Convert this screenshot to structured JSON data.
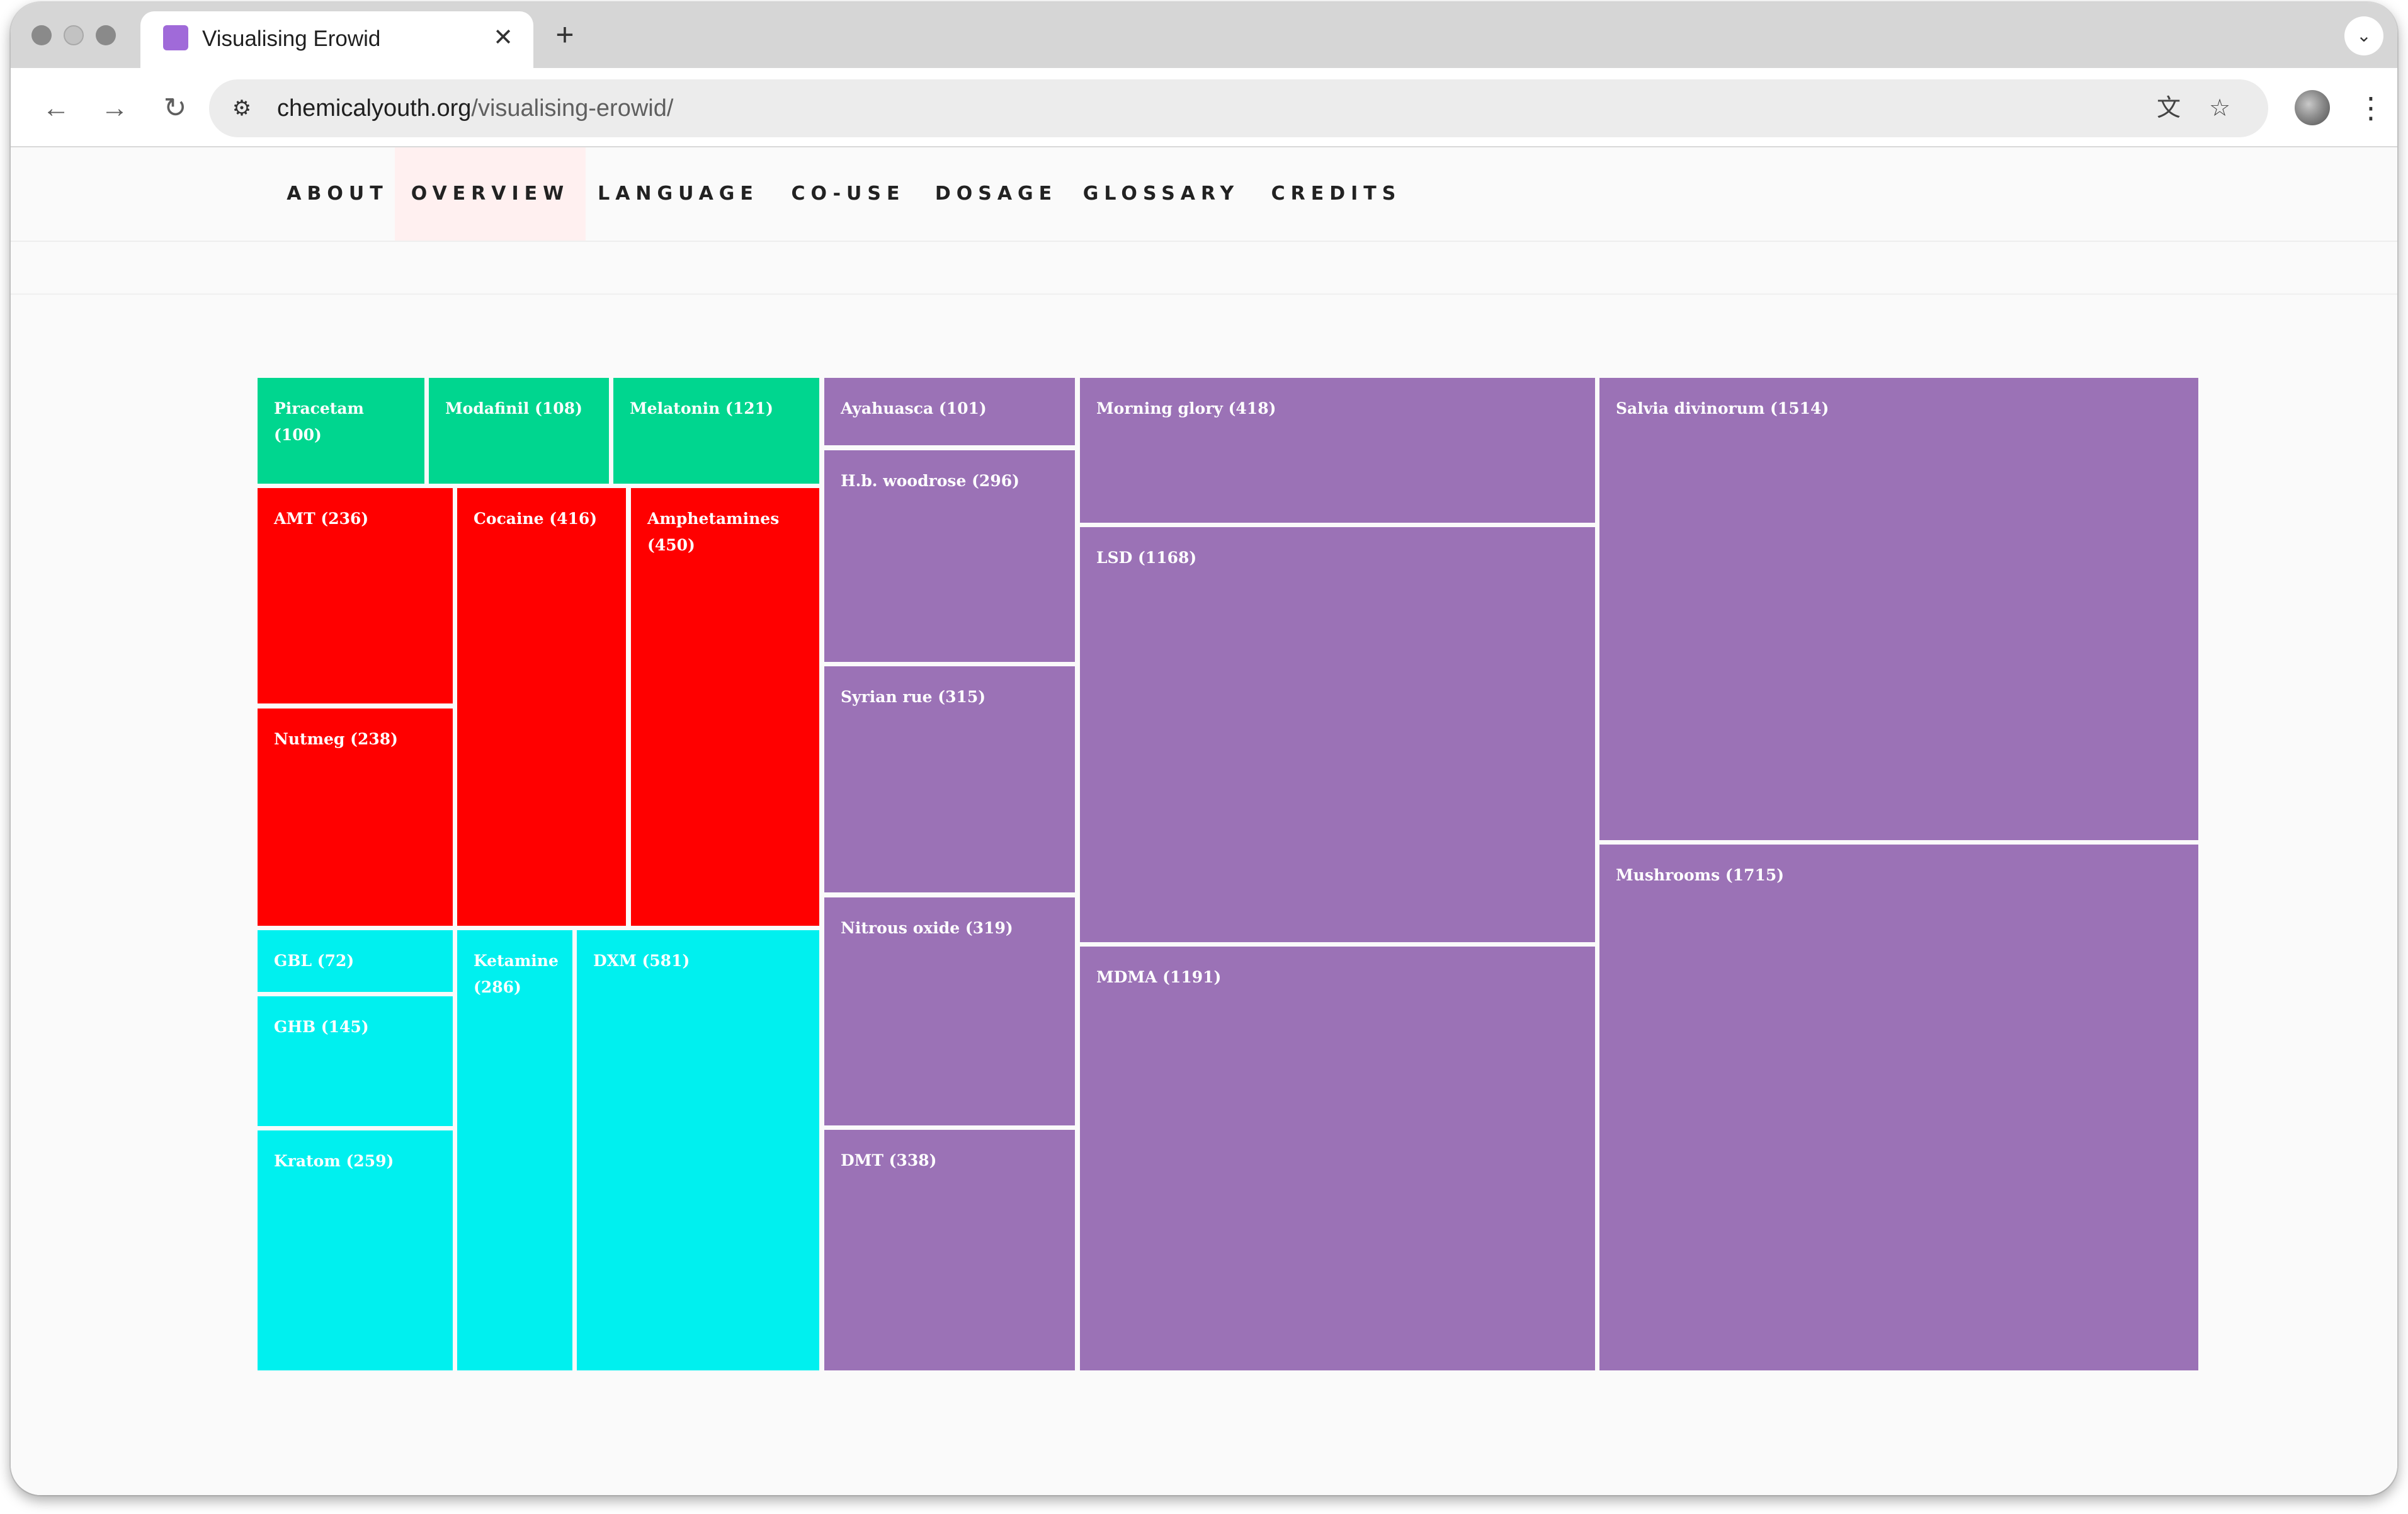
{
  "browser": {
    "tab_title": "Visualising Erowid",
    "tab_favicon_color": "#a06ad9",
    "url_host": "chemicalyouth.org",
    "url_path": "/visualising-erowid/",
    "icons": {
      "close": "close-icon",
      "new_tab": "plus-icon",
      "tab_search": "chevron-down-icon",
      "back": "back-arrow-icon",
      "forward": "forward-arrow-icon",
      "reload": "reload-icon",
      "site_info": "tune-icon",
      "translate": "translate-icon",
      "bookmark": "star-icon",
      "profile": "avatar",
      "menu": "kebab-menu-icon"
    }
  },
  "site_nav": {
    "items": [
      {
        "label": "ABOUT",
        "active": false
      },
      {
        "label": "OVERVIEW",
        "active": true
      },
      {
        "label": "LANGUAGE",
        "active": false
      },
      {
        "label": "CO-USE",
        "active": false
      },
      {
        "label": "DOSAGE",
        "active": false
      },
      {
        "label": "GLOSSARY",
        "active": false
      },
      {
        "label": "CREDITS",
        "active": false
      }
    ]
  },
  "colors": {
    "group_green": "#00d68f",
    "group_red": "#ff0000",
    "group_cyan": "#00f0ef",
    "group_purple": "#9b72b6"
  },
  "chart_data": {
    "type": "treemap",
    "groups": [
      {
        "color": "#00d68f",
        "items": [
          {
            "name": "Piracetam",
            "value": 100,
            "label": "Piracetam (100)"
          },
          {
            "name": "Modafinil",
            "value": 108,
            "label": "Modafinil (108)"
          },
          {
            "name": "Melatonin",
            "value": 121,
            "label": "Melatonin (121)"
          }
        ]
      },
      {
        "color": "#ff0000",
        "items": [
          {
            "name": "AMT",
            "value": 236,
            "label": "AMT (236)"
          },
          {
            "name": "Nutmeg",
            "value": 238,
            "label": "Nutmeg (238)"
          },
          {
            "name": "Cocaine",
            "value": 416,
            "label": "Cocaine (416)"
          },
          {
            "name": "Amphetamines",
            "value": 450,
            "label": "Amphetamines (450)"
          }
        ]
      },
      {
        "color": "#00f0ef",
        "items": [
          {
            "name": "GBL",
            "value": 72,
            "label": "GBL (72)"
          },
          {
            "name": "GHB",
            "value": 145,
            "label": "GHB (145)"
          },
          {
            "name": "Kratom",
            "value": 259,
            "label": "Kratom (259)"
          },
          {
            "name": "Ketamine",
            "value": 286,
            "label": "Ketamine (286)"
          },
          {
            "name": "DXM",
            "value": 581,
            "label": "DXM (581)"
          }
        ]
      },
      {
        "color": "#9b72b6",
        "items": [
          {
            "name": "Ayahuasca",
            "value": 101,
            "label": "Ayahuasca (101)"
          },
          {
            "name": "H.b. woodrose",
            "value": 296,
            "label": "H.b. woodrose (296)"
          },
          {
            "name": "Syrian rue",
            "value": 315,
            "label": "Syrian rue (315)"
          },
          {
            "name": "Nitrous oxide",
            "value": 319,
            "label": "Nitrous oxide (319)"
          },
          {
            "name": "DMT",
            "value": 338,
            "label": "DMT (338)"
          },
          {
            "name": "Morning glory",
            "value": 418,
            "label": "Morning glory (418)"
          },
          {
            "name": "LSD",
            "value": 1168,
            "label": "LSD (1168)"
          },
          {
            "name": "MDMA",
            "value": 1191,
            "label": "MDMA (1191)"
          },
          {
            "name": "Salvia divinorum",
            "value": 1514,
            "label": "Salvia divinorum (1514)"
          },
          {
            "name": "Mushrooms",
            "value": 1715,
            "label": "Mushrooms (1715)"
          }
        ]
      }
    ]
  }
}
